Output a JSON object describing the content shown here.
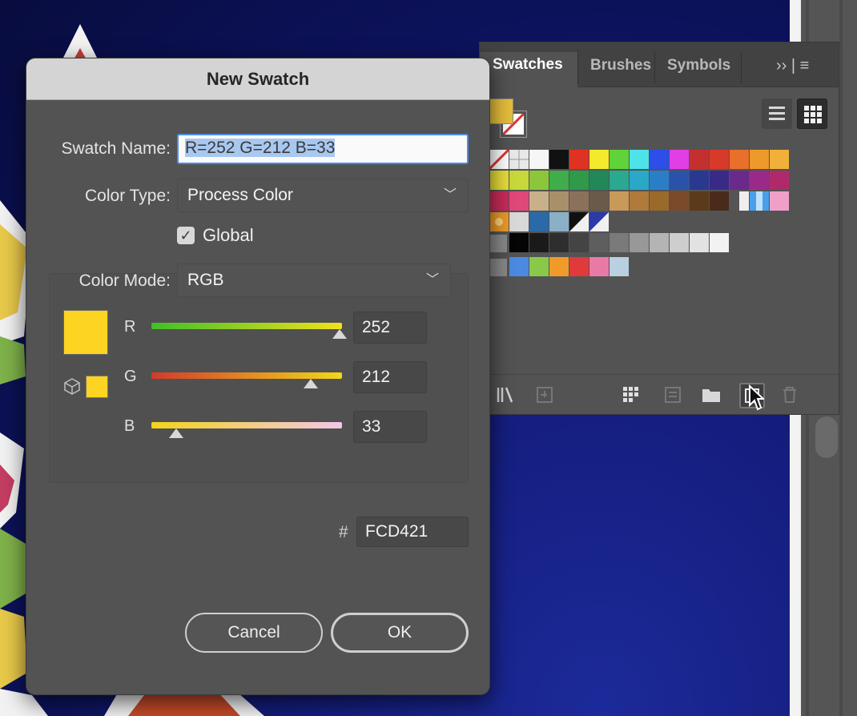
{
  "dialog": {
    "title": "New Swatch",
    "swatch_name_label": "Swatch Name:",
    "swatch_name_value": "R=252 G=212 B=33",
    "color_type_label": "Color Type:",
    "color_type_value": "Process Color",
    "global_label": "Global",
    "global_checked": true,
    "color_mode_label": "Color Mode:",
    "color_mode_value": "RGB",
    "channels": [
      {
        "label": "R",
        "value": "252"
      },
      {
        "label": "G",
        "value": "212"
      },
      {
        "label": "B",
        "value": "33"
      }
    ],
    "hex_prefix": "#",
    "hex_value": "FCD421",
    "cancel_label": "Cancel",
    "ok_label": "OK",
    "preview_color": "#FCD421"
  },
  "panel": {
    "tabs": [
      {
        "label": "Swatches",
        "active": true
      },
      {
        "label": "Brushes",
        "active": false
      },
      {
        "label": "Symbols",
        "active": false
      }
    ],
    "menu_glyphs": "›› | ≡",
    "fill_color": "#e6bd3b"
  },
  "colors": {
    "accent": "#4c8de8",
    "canvas": "#141d7c",
    "panel_bg": "#535353"
  }
}
